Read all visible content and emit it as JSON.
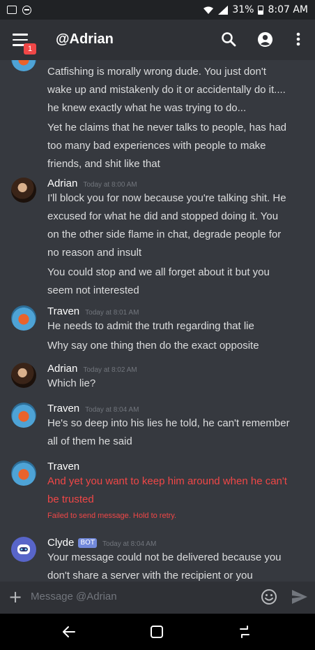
{
  "status_bar": {
    "battery": "31%",
    "time": "8:07 AM"
  },
  "app_bar": {
    "title": "@Adrian",
    "badge_count": "1"
  },
  "messages": [
    {
      "lines": [
        "Catfishing is morally wrong dude. You just don't",
        "wake up and mistakenly do it or accidentally do it....",
        "he knew exactly what he was trying to do...",
        "Yet he claims that he never talks to people, has had",
        "too many bad experiences with people to make",
        "friends, and shit like that"
      ]
    },
    {
      "author": "Adrian",
      "timestamp": "Today at 8:00 AM",
      "lines": [
        "I'll block you for now because you're talking shit. He",
        "excused for what he did and stopped doing it. You",
        "on the other side flame in chat, degrade people for",
        "no reason and insult",
        "You could stop and we all forget about it but you",
        "seem not interested"
      ]
    },
    {
      "author": "Traven",
      "timestamp": "Today at 8:01 AM",
      "lines": [
        "He needs to admit the truth regarding that lie",
        "Why say one thing then do the exact opposite"
      ]
    },
    {
      "author": "Adrian",
      "timestamp": "Today at 8:02 AM",
      "lines": [
        "Which lie?"
      ]
    },
    {
      "author": "Traven",
      "timestamp": "Today at 8:04 AM",
      "lines": [
        "He's so deep into his lies he told, he can't remember",
        "all of them he said"
      ]
    },
    {
      "author": "Traven",
      "lines": [
        "And yet you want to keep him around when he can't",
        "be trusted"
      ],
      "fail_note": "Failed to send message. Hold to retry."
    },
    {
      "author": "Clyde",
      "bot_tag": "BOT",
      "timestamp": "Today at 8:04 AM",
      "lines": [
        "Your message could not be delivered because you",
        "don't share a server with the recipient or you"
      ]
    }
  ],
  "composer": {
    "placeholder": "Message @Adrian"
  },
  "colors": {
    "background": "#36393f",
    "header": "#2f3136",
    "error": "#f04747",
    "bot_tag": "#7289da"
  },
  "icons": {
    "status_left": [
      "image-icon",
      "do-not-disturb-icon"
    ],
    "status_right": [
      "wifi-icon",
      "signal-icon",
      "battery-icon"
    ],
    "app_bar": [
      "menu-icon",
      "search-icon",
      "account-icon",
      "more-vert-icon"
    ],
    "composer": [
      "plus-icon",
      "emoji-icon",
      "send-icon"
    ],
    "navbar": [
      "back-icon",
      "home-icon",
      "recents-icon"
    ]
  }
}
